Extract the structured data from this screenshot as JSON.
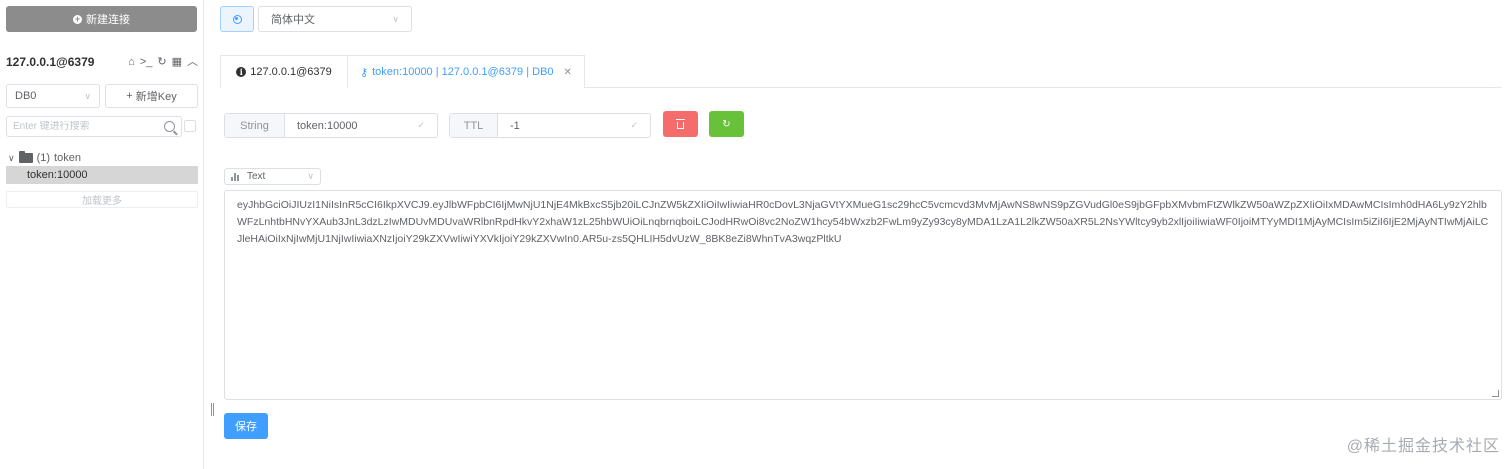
{
  "sidebar": {
    "new_connection_label": "新建连接",
    "connection_name": "127.0.0.1@6379",
    "db_select_value": "DB0",
    "add_key_label": "新增Key",
    "search_placeholder": "Enter 键进行搜索",
    "tree": {
      "folder_count": "(1)",
      "folder_name": "token",
      "selected_key": "token:10000"
    },
    "load_more_label": "加载更多"
  },
  "topbar": {
    "language_value": "简体中文"
  },
  "tabs": [
    {
      "label": "127.0.0.1@6379",
      "active": false
    },
    {
      "label": "token:10000 | 127.0.0.1@6379 | DB0",
      "active": true
    }
  ],
  "key_info": {
    "type_label": "String",
    "key_name": "token:10000",
    "ttl_label": "TTL",
    "ttl_value": "-1"
  },
  "value_editor": {
    "format": "Text",
    "value": "eyJhbGciOiJIUzI1NiIsInR5cCI6IkpXVCJ9.eyJlbWFpbCI6IjMwNjU1NjE4MkBxcS5jb20iLCJnZW5kZXIiOiIwIiwiaHR0cDovL3NjaGVtYXMueG1sc29hcC5vcmcvd3MvMjAwNS8wNS9pZGVudGl0eS9jbGFpbXMvbmFtZWlkZW50aWZpZXIiOiIxMDAwMCIsImh0dHA6Ly9zY2hlbWFzLnhtbHNvYXAub3JnL3dzLzIwMDUvMDUvaWRlbnRpdHkvY2xhaW1zL25hbWUiOiLnqbrnqboiLCJodHRwOi8vc2NoZW1hcy54bWxzb2FwLm9yZy93cy8yMDA1LzA1L2lkZW50aXR5L2NsYWltcy9yb2xlIjoiIiwiaWF0IjoiMTYyMDI1MjAyMCIsIm5iZiI6IjE2MjAyNTIwMjAiLCJleHAiOiIxNjIwMjU1NjIwIiwiaXNzIjoiY29kZXVwIiwiYXVkIjoiY29kZXVwIn0.AR5u-zs5QHLIH5dvUzW_8BK8eZi8WhnTvA3wqzPltkU"
  },
  "save_label": "保存",
  "watermark": "@稀土掘金技术社区"
}
